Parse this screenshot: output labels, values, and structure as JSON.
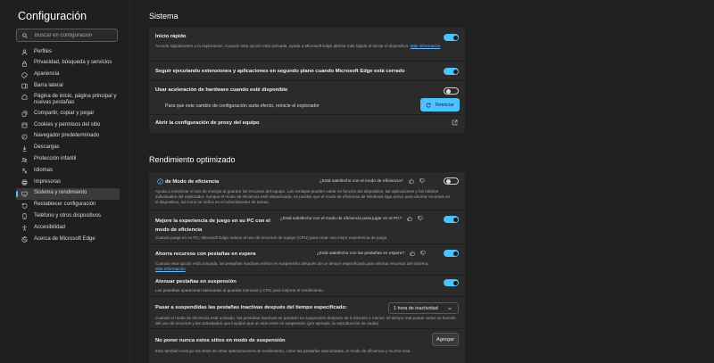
{
  "sidebar": {
    "title": "Configuración",
    "search_placeholder": "Buscar en configuración",
    "items": [
      {
        "label": "Perfiles"
      },
      {
        "label": "Privacidad, búsqueda y servicios"
      },
      {
        "label": "Apariencia"
      },
      {
        "label": "Barra lateral"
      },
      {
        "label": "Página de inicio, página principal y nuevas pestañas"
      },
      {
        "label": "Compartir, copiar y pegar"
      },
      {
        "label": "Cookies y permisos del sitio"
      },
      {
        "label": "Navegador predeterminado"
      },
      {
        "label": "Descargas"
      },
      {
        "label": "Protección infantil"
      },
      {
        "label": "Idiomas"
      },
      {
        "label": "Impresoras"
      },
      {
        "label": "Sistema y rendimiento"
      },
      {
        "label": "Restablecer configuración"
      },
      {
        "label": "Teléfono y otros dispositivos"
      },
      {
        "label": "Accesibilidad"
      },
      {
        "label": "Acerca de Microsoft Edge"
      }
    ]
  },
  "sistema": {
    "title": "Sistema",
    "startup_boost": {
      "label": "Inicio rápido",
      "desc": "Acceda rápidamente a la exploración. Cuando esta opción está activada, ayuda a Microsoft Edge abrirse más rápido al iniciar el dispositivo.",
      "link": "Más información",
      "enabled": true
    },
    "background": {
      "label": "Seguir ejecutando extensiones y aplicaciones en segundo plano cuando Microsoft Edge está cerrado",
      "enabled": true
    },
    "hardware": {
      "label": "Usar aceleración de hardware cuando esté disponible",
      "enabled": false,
      "restart_msg": "Para que este cambio de configuración surta efecto, reinicie el explorador",
      "restart_button": "Reiniciar"
    },
    "proxy": {
      "label": "Abrir la configuración de proxy del equipo"
    }
  },
  "rendimiento": {
    "title": "Rendimiento optimizado",
    "efficiency": {
      "label": "de Modo de eficiencia",
      "feedback": "¿Está satisfecho con el modo de eficiencia?",
      "desc": "Ayuda a minimizar el uso de energía al guardar los recursos del equipo. Las ventajas pueden variar en función del dispositivo, las aplicaciones y los hábitos individuales del explorador. Aunque el modo de eficiencia esté desactivado, es posible que el modo de eficiencia de Windows siga activo para ahorrar recursos en el dispositivo, tal como se indica en el Administrador de tareas.",
      "enabled": false
    },
    "gaming": {
      "label": "Mejore la experiencia de juego en su PC con el modo de eficiencia",
      "feedback": "¿Está satisfecho con el modo de eficiencia para jugar en el PC?",
      "desc": "Cuando juega en su PC, Microsoft Edge reduce el uso de recursos de equipo (CPU) para crear una mejor experiencia de juego.",
      "enabled": true
    },
    "sleeping": {
      "label": "Ahorra recursos con pestañas en espera",
      "feedback": "¿Está satisfecho con las pestañas en espera?",
      "desc": "Cuando esta opción está activada, las pestañas inactivas entran en suspensión después de un tiempo especificado para ahorrar recursos del sistema.",
      "link": "Más información",
      "enabled": true
    },
    "fade": {
      "label": "Atenuar pestañas en suspensión",
      "desc": "Las pestañas aparecerán atenuadas al guardar memoria y CPU para mejorar el rendimiento.",
      "enabled": true
    },
    "inactive": {
      "label": "Pasar a suspendidas las pestañas inactivas después del tiempo especificado:",
      "desc": "Cuando el modo de eficiencia está activado, las pestañas inactivas se pondrán en suspensión después de 5 minutos o menos. El tiempo real puede variar en función del uso de recursos y las actividades que impidan que un sitio entre en suspensión (por ejemplo, la reproducción de audio).",
      "value": "1 hora de inactividad"
    },
    "never_sleep": {
      "label": "No poner nunca estos sitios en modo de suspensión",
      "button": "Agregar",
      "desc": "Esto también excluye los sitios de otras optimizaciones de rendimiento, como las pestañas descartadas, el modo de eficiencia y mucho más."
    }
  },
  "colors": {
    "accent": "#4cc2ff",
    "background": "#202020",
    "card": "#2b2b2b"
  }
}
